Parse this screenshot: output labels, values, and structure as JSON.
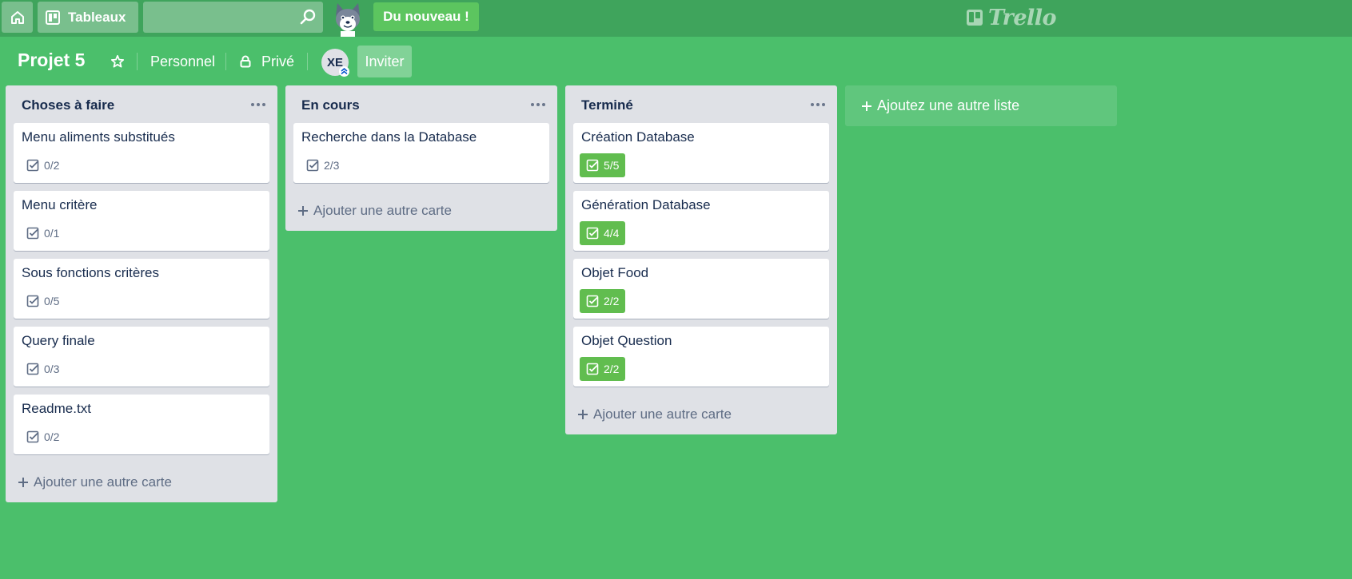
{
  "topbar": {
    "home_icon": "home-icon",
    "boards_label": "Tableaux",
    "search_value": "",
    "whats_new_label": "Du nouveau !",
    "logo_text": "Trello"
  },
  "board": {
    "title": "Projet 5",
    "team_label": "Personnel",
    "visibility_label": "Privé",
    "member_initials": "XE",
    "invite_label": "Inviter"
  },
  "lists": [
    {
      "title": "Choses à faire",
      "cards": [
        {
          "title": "Menu aliments substitués",
          "checklist": "0/2",
          "complete": false
        },
        {
          "title": "Menu critère",
          "checklist": "0/1",
          "complete": false
        },
        {
          "title": "Sous fonctions critères",
          "checklist": "0/5",
          "complete": false
        },
        {
          "title": "Query finale",
          "checklist": "0/3",
          "complete": false
        },
        {
          "title": "Readme.txt",
          "checklist": "0/2",
          "complete": false
        }
      ],
      "add_card_label": "Ajouter une autre carte"
    },
    {
      "title": "En cours",
      "cards": [
        {
          "title": "Recherche dans la Database",
          "checklist": "2/3",
          "complete": false
        }
      ],
      "add_card_label": "Ajouter une autre carte"
    },
    {
      "title": "Terminé",
      "cards": [
        {
          "title": "Création Database",
          "checklist": "5/5",
          "complete": true
        },
        {
          "title": "Génération Database",
          "checklist": "4/4",
          "complete": true
        },
        {
          "title": "Objet Food",
          "checklist": "2/2",
          "complete": true
        },
        {
          "title": "Objet Question",
          "checklist": "2/2",
          "complete": true
        }
      ],
      "add_card_label": "Ajouter une autre carte"
    }
  ],
  "add_list_label": "Ajoutez une autre liste",
  "colors": {
    "board_background": "#4bbf6b",
    "topbar": "#3fa45c",
    "complete_badge": "#61bd4f",
    "whats_new": "#5cc55f"
  }
}
